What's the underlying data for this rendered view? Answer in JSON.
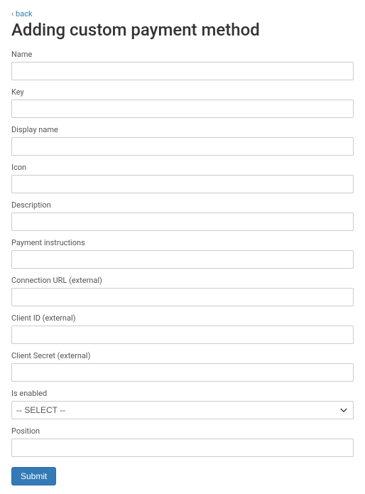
{
  "nav": {
    "back_label": "‹ back"
  },
  "page": {
    "title": "Adding custom payment method"
  },
  "form": {
    "fields": {
      "name": {
        "label": "Name",
        "value": ""
      },
      "key": {
        "label": "Key",
        "value": ""
      },
      "display_name": {
        "label": "Display name",
        "value": ""
      },
      "icon": {
        "label": "Icon",
        "value": ""
      },
      "description": {
        "label": "Description",
        "value": ""
      },
      "payment_instructions": {
        "label": "Payment instructions",
        "value": ""
      },
      "connection_url": {
        "label": "Connection URL (external)",
        "value": ""
      },
      "client_id": {
        "label": "Client ID (external)",
        "value": ""
      },
      "client_secret": {
        "label": "Client Secret (external)",
        "value": ""
      },
      "is_enabled": {
        "label": "Is enabled",
        "selected": "-- SELECT --"
      },
      "position": {
        "label": "Position",
        "value": ""
      }
    },
    "submit_label": "Submit"
  }
}
